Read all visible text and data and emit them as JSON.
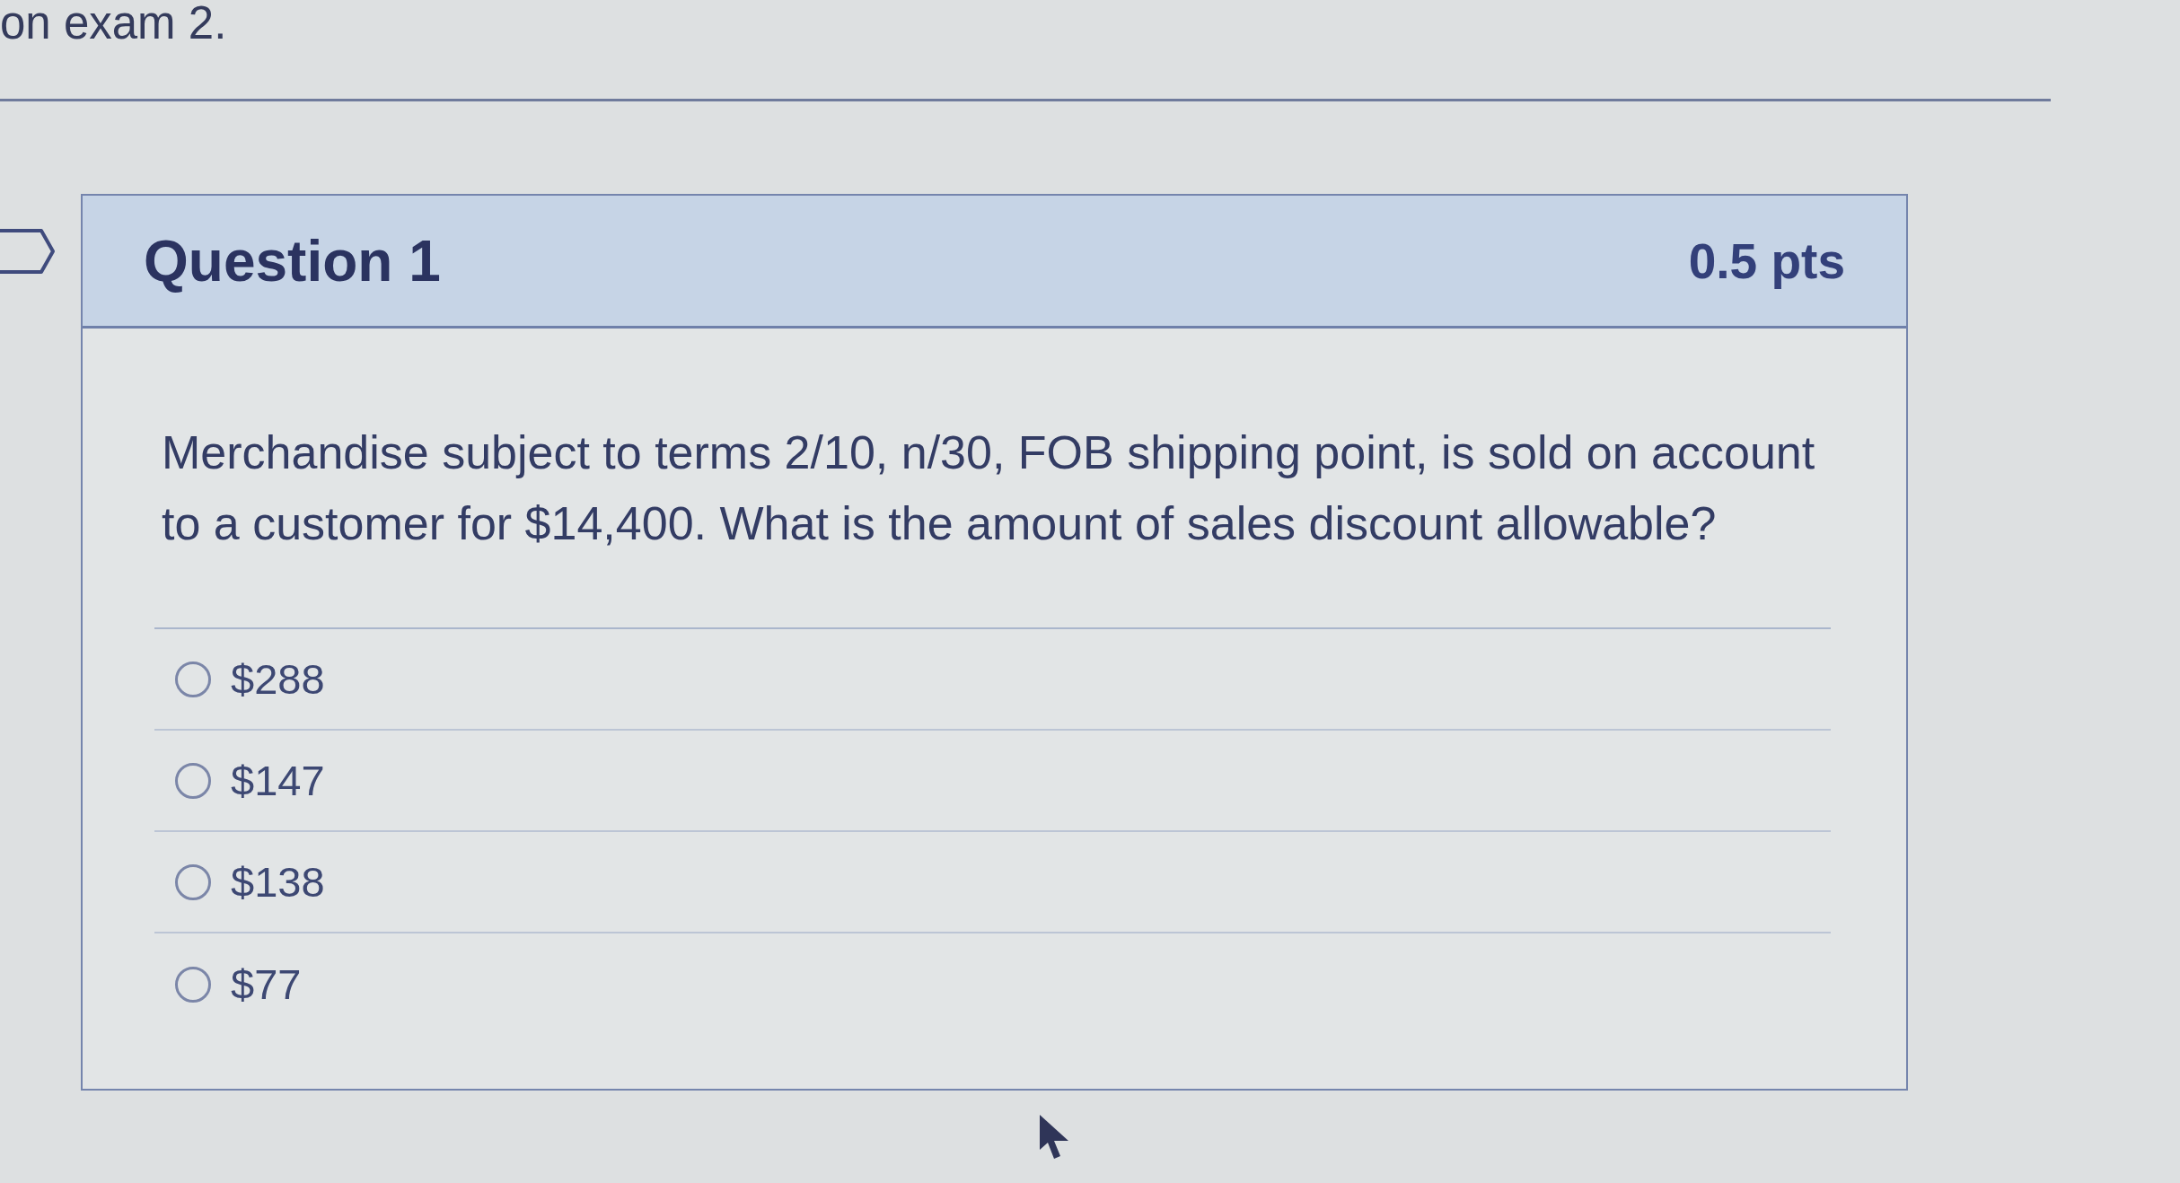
{
  "page_title": "on exam 2.",
  "question": {
    "flagged": false,
    "title": "Question 1",
    "points": "0.5 pts",
    "text": "Merchandise subject to terms 2/10, n/30, FOB shipping point, is sold on account to a customer for $14,400. What is the amount of sales discount allowable?",
    "answers": [
      {
        "label": "$288",
        "selected": false
      },
      {
        "label": "$147",
        "selected": false
      },
      {
        "label": "$138",
        "selected": false
      },
      {
        "label": "$77",
        "selected": false
      }
    ]
  }
}
